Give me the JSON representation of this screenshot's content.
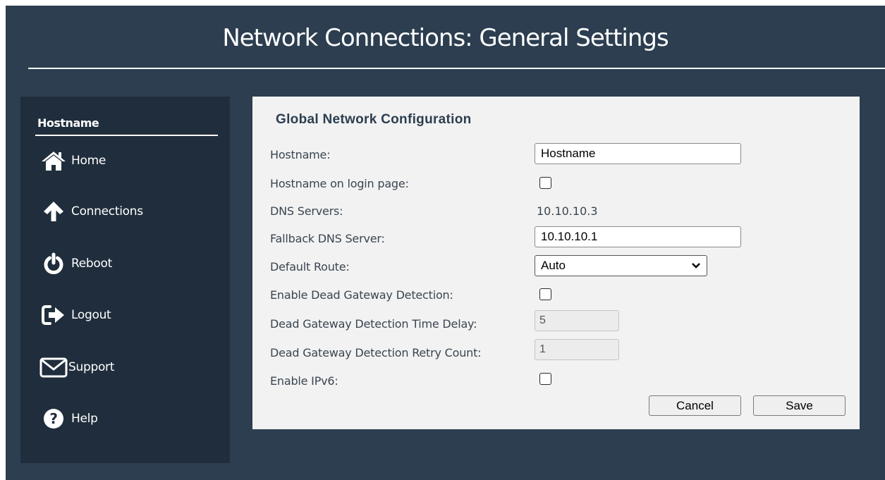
{
  "header": {
    "title": "Network Connections: General Settings"
  },
  "sidebar": {
    "heading": "Hostname",
    "items": [
      {
        "label": "Home",
        "icon": "home-icon"
      },
      {
        "label": "Connections",
        "icon": "arrow-up-icon"
      },
      {
        "label": "Reboot",
        "icon": "power-icon"
      },
      {
        "label": "Logout",
        "icon": "logout-icon"
      },
      {
        "label": "Support",
        "icon": "envelope-icon"
      },
      {
        "label": "Help",
        "icon": "question-icon"
      }
    ]
  },
  "form": {
    "heading": "Global Network Configuration",
    "hostname": {
      "label": "Hostname:",
      "value": "Hostname"
    },
    "hostname_on_login": {
      "label": "Hostname on login page:",
      "checked": false
    },
    "dns_servers": {
      "label": "DNS Servers:",
      "value": "10.10.10.3"
    },
    "fallback_dns": {
      "label": "Fallback DNS Server:",
      "value": "10.10.10.1"
    },
    "default_route": {
      "label": "Default Route:",
      "value": "Auto"
    },
    "dead_gateway": {
      "label": "Enable Dead Gateway Detection:",
      "checked": false
    },
    "time_delay": {
      "label": "Dead Gateway Detection Time Delay:",
      "value": "5"
    },
    "retry_count": {
      "label": "Dead Gateway Detection Retry Count:",
      "value": "1"
    },
    "ipv6": {
      "label": "Enable IPv6:",
      "checked": false
    },
    "cancel_label": "Cancel",
    "save_label": "Save"
  },
  "colors": {
    "background": "#2c3e50",
    "sidebar": "#1f2d3c",
    "panel": "#f2f2f2",
    "text": "#ffffff"
  }
}
